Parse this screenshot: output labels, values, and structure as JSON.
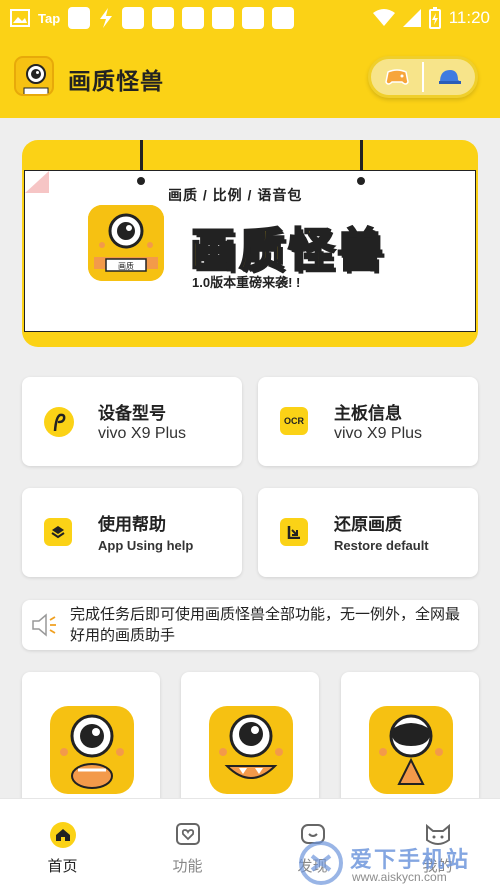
{
  "status_bar": {
    "tap": "Tap",
    "time": "11:20"
  },
  "header": {
    "title": "画质怪兽"
  },
  "banner": {
    "subtitle": "画质 / 比例 / 语音包",
    "title": "画质怪兽",
    "tagline": "1.0版本重磅来袭! !",
    "icon_label": "画质"
  },
  "cards": [
    {
      "title": "设备型号",
      "subtitle": "vivo X9 Plus",
      "icon": "device-model-icon"
    },
    {
      "title": "主板信息",
      "subtitle": "vivo X9 Plus",
      "icon": "ocr-icon",
      "icon_text": "OCR"
    },
    {
      "title": "使用帮助",
      "subtitle": "App Using help",
      "icon": "help-layers-icon"
    },
    {
      "title": "还原画质",
      "subtitle": "Restore default",
      "icon": "restore-icon"
    }
  ],
  "notice": {
    "text": "完成任务后即可使用画质怪兽全部功能，无一例外，全网最好用的画质助手"
  },
  "nav": [
    {
      "label": "首页",
      "icon": "home-icon",
      "active": true
    },
    {
      "label": "功能",
      "icon": "heart-box-icon",
      "active": false
    },
    {
      "label": "发现",
      "icon": "discover-icon",
      "active": false
    },
    {
      "label": "我的",
      "icon": "cat-face-icon",
      "active": false
    }
  ],
  "watermark": {
    "text": "爱下手机站",
    "url": "www.aiskycn.com"
  },
  "colors": {
    "accent": "#fbd216",
    "monster": "#f6c112",
    "background": "#eeeeee"
  }
}
